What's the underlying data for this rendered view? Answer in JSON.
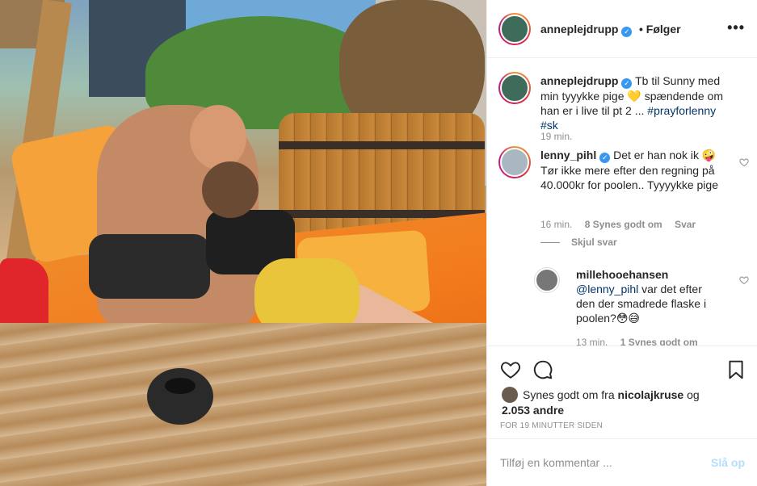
{
  "post": {
    "author": "anneplejdrupp",
    "follow_status": "Følger",
    "more_icon": "more-options-icon"
  },
  "caption": {
    "author": "anneplejdrupp",
    "text": "Tb til Sunny med min tyyykke pige 💛 spændende om han er i live til pt 2 ...",
    "hashtags": "#prayforlenny #sk",
    "time": "19 min."
  },
  "comments": [
    {
      "author": "lenny_pihl",
      "text": "Det er han nok ik 🤪 Tør ikke mere efter den regning på 40.000kr for poolen.. Tyyyykke pige",
      "time": "16 min.",
      "likes": "8 Synes godt om",
      "reply_label": "Svar",
      "hide_replies": "Skjul svar",
      "replies": [
        {
          "author": "millehooehansen",
          "mention": "@lenny_pihl",
          "text": "var det efter den der smadrede flaske i poolen?😳😅",
          "time": "13 min.",
          "likes": "1 Synes godt om"
        }
      ]
    }
  ],
  "likes": {
    "prefix": "Synes godt om fra",
    "user": "nicolajkruse",
    "joiner": "og",
    "others": "2.053 andre"
  },
  "timestamp": "FOR 19 MINUTTER SIDEN",
  "add_comment": {
    "placeholder": "Tilføj en kommentar ...",
    "post_label": "Slå op"
  },
  "colors": {
    "link": "#003569",
    "verified": "#3897f0",
    "muted": "#8e8e8e",
    "post_disabled": "#b2dffc"
  }
}
